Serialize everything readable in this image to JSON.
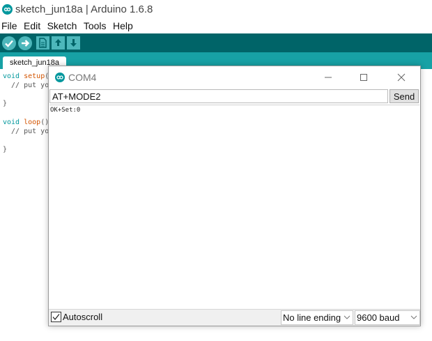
{
  "window": {
    "title": "sketch_jun18a | Arduino 1.6.8",
    "icon": "arduino-logo-icon"
  },
  "menu": {
    "items": [
      "File",
      "Edit",
      "Sketch",
      "Tools",
      "Help"
    ]
  },
  "toolbar": {
    "buttons": [
      "verify-icon",
      "upload-icon",
      "new-icon",
      "open-icon",
      "save-icon"
    ]
  },
  "tabs": {
    "active": "sketch_jun18a"
  },
  "editor": {
    "lines": [
      {
        "kw": "void",
        "fn": "setup",
        "rest": "("
      },
      {
        "kw": "",
        "fn": "",
        "rest": "  // put yo"
      },
      {
        "kw": "",
        "fn": "",
        "rest": "}"
      },
      {
        "kw": "void",
        "fn": "loop",
        "rest": "()"
      },
      {
        "kw": "",
        "fn": "",
        "rest": "  // put yo"
      },
      {
        "kw": "",
        "fn": "",
        "rest": "}"
      }
    ]
  },
  "serial_monitor": {
    "title": "COM4",
    "input_value": "AT+MODE2",
    "send_label": "Send",
    "output": "OK+Set:0",
    "autoscroll_label": "Autoscroll",
    "autoscroll_checked": true,
    "line_ending": "No line ending",
    "baud": "9600 baud",
    "controls": [
      "minimize-icon",
      "maximize-icon",
      "close-icon"
    ]
  },
  "colors": {
    "toolbar": "#006468",
    "tabbar": "#17a1a5",
    "button": "#4db7bb",
    "keyword": "#00979c",
    "function": "#d35400"
  }
}
